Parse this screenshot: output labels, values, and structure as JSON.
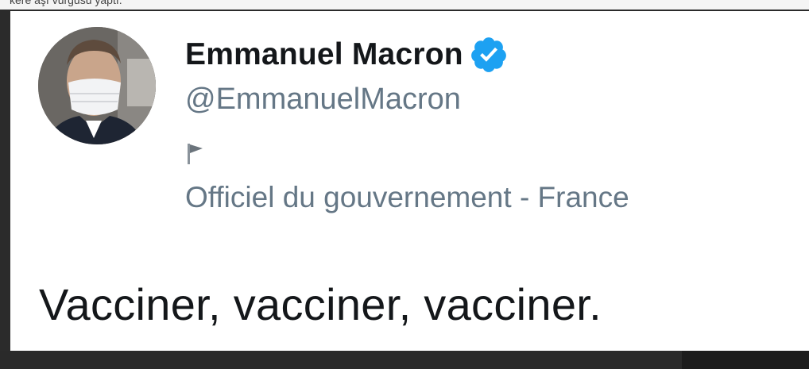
{
  "page": {
    "top_caption": "kere aşı vurgusu yaptı."
  },
  "profile": {
    "display_name": "Emmanuel Macron",
    "handle": "@EmmanuelMacron",
    "verified": true,
    "verified_icon": "verified-badge-icon",
    "label_icon": "flag-icon",
    "label": "Officiel du gouvernement - France"
  },
  "tweet": {
    "text": "Vacciner, vacciner, vacciner."
  },
  "colors": {
    "name": "#14171a",
    "secondary_text": "#657786",
    "verified_blue": "#1da1f2",
    "card_background": "#ffffff",
    "page_frame": "#2b2b2b"
  }
}
